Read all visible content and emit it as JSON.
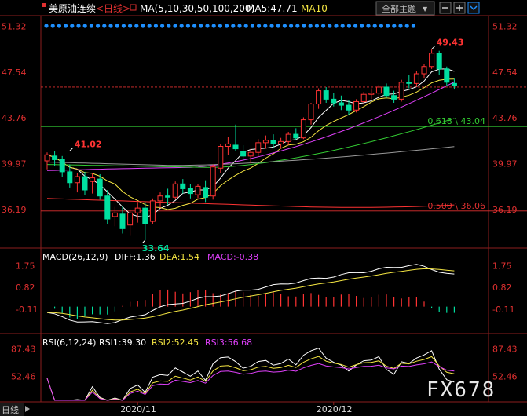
{
  "header": {
    "instrument": "美原油连续",
    "period": "<日线>",
    "ma_label": "MA(5,10,30,50,100,200)",
    "ma5_label": "MA5:47.71",
    "ma10_label": "MA10",
    "theme_button": "全部主题",
    "theme_arrow": "▼"
  },
  "watermark": "FX678",
  "bottom_tab": "日线",
  "colors": {
    "up": "#ff3333",
    "down": "#00e0a0",
    "ma5": "#ffffff",
    "ma10": "#f5e642",
    "ma30": "#e040fb",
    "ma50": "#33cc33",
    "ma100": "#999999",
    "ma200": "#ff3333",
    "axis_text": "#e03030",
    "dot_row": "#1e90ff"
  },
  "chart_data": {
    "type": "candlestick",
    "x_ticks": [
      "2020/11",
      "2020/12"
    ],
    "price_panel": {
      "y_ticks": [
        "51.32",
        "47.54",
        "43.76",
        "39.97",
        "36.19"
      ],
      "ylim": [
        33.0,
        52.2
      ],
      "annotations": [
        {
          "label": "49.43",
          "value": 49.43,
          "index": 51
        },
        {
          "label": "41.02",
          "value": 41.02,
          "index": 3
        },
        {
          "label": "33.64",
          "value": 33.64,
          "index": 13
        }
      ],
      "reference_lines": [
        {
          "label": "",
          "value": 46.3,
          "style": "dashed"
        },
        {
          "label": "0.618 \\ 43.04",
          "value": 43.04,
          "style": "solid"
        },
        {
          "label": "0.500 \\ 36.06",
          "value": 36.06,
          "style": "solid"
        }
      ],
      "candles": [
        {
          "o": 40.2,
          "h": 40.9,
          "l": 39.5,
          "c": 40.7
        },
        {
          "o": 40.6,
          "h": 41.02,
          "l": 39.8,
          "c": 40.3
        },
        {
          "o": 40.3,
          "h": 40.6,
          "l": 38.9,
          "c": 39.3
        },
        {
          "o": 39.3,
          "h": 39.9,
          "l": 38.0,
          "c": 38.4
        },
        {
          "o": 38.4,
          "h": 39.2,
          "l": 37.6,
          "c": 38.9
        },
        {
          "o": 38.9,
          "h": 39.3,
          "l": 37.4,
          "c": 37.8
        },
        {
          "o": 38.5,
          "h": 39.2,
          "l": 37.5,
          "c": 38.8
        },
        {
          "o": 38.7,
          "h": 39.1,
          "l": 37.0,
          "c": 37.3
        },
        {
          "o": 37.3,
          "h": 37.8,
          "l": 35.0,
          "c": 35.4
        },
        {
          "o": 35.6,
          "h": 36.4,
          "l": 34.8,
          "c": 35.9
        },
        {
          "o": 35.8,
          "h": 36.5,
          "l": 34.2,
          "c": 34.6
        },
        {
          "o": 34.9,
          "h": 36.2,
          "l": 34.0,
          "c": 35.9
        },
        {
          "o": 35.9,
          "h": 36.8,
          "l": 35.1,
          "c": 36.3
        },
        {
          "o": 36.3,
          "h": 36.8,
          "l": 33.64,
          "c": 35.0
        },
        {
          "o": 35.2,
          "h": 37.1,
          "l": 35.0,
          "c": 36.9
        },
        {
          "o": 36.9,
          "h": 37.6,
          "l": 36.3,
          "c": 37.3
        },
        {
          "o": 37.3,
          "h": 37.9,
          "l": 36.6,
          "c": 37.2
        },
        {
          "o": 37.2,
          "h": 38.5,
          "l": 37.0,
          "c": 38.3
        },
        {
          "o": 38.3,
          "h": 38.7,
          "l": 37.5,
          "c": 37.9
        },
        {
          "o": 37.9,
          "h": 38.3,
          "l": 37.1,
          "c": 37.5
        },
        {
          "o": 37.4,
          "h": 38.3,
          "l": 37.1,
          "c": 38.1
        },
        {
          "o": 38.0,
          "h": 38.6,
          "l": 36.8,
          "c": 37.2
        },
        {
          "o": 37.3,
          "h": 39.9,
          "l": 37.0,
          "c": 39.7
        },
        {
          "o": 39.6,
          "h": 41.6,
          "l": 39.2,
          "c": 41.4
        },
        {
          "o": 41.4,
          "h": 42.2,
          "l": 40.7,
          "c": 41.6
        },
        {
          "o": 41.5,
          "h": 43.2,
          "l": 41.0,
          "c": 41.2
        },
        {
          "o": 41.0,
          "h": 41.5,
          "l": 40.2,
          "c": 40.6
        },
        {
          "o": 40.6,
          "h": 41.2,
          "l": 40.0,
          "c": 40.9
        },
        {
          "o": 40.9,
          "h": 42.0,
          "l": 40.6,
          "c": 41.7
        },
        {
          "o": 41.7,
          "h": 42.3,
          "l": 41.2,
          "c": 41.9
        },
        {
          "o": 41.9,
          "h": 42.4,
          "l": 41.3,
          "c": 41.6
        },
        {
          "o": 41.6,
          "h": 42.1,
          "l": 41.2,
          "c": 41.8
        },
        {
          "o": 41.8,
          "h": 42.6,
          "l": 41.5,
          "c": 42.4
        },
        {
          "o": 42.4,
          "h": 42.9,
          "l": 41.9,
          "c": 42.1
        },
        {
          "o": 42.1,
          "h": 43.8,
          "l": 42.0,
          "c": 43.6
        },
        {
          "o": 43.6,
          "h": 45.0,
          "l": 43.2,
          "c": 44.9
        },
        {
          "o": 44.9,
          "h": 46.2,
          "l": 44.5,
          "c": 46.0
        },
        {
          "o": 46.0,
          "h": 46.3,
          "l": 45.0,
          "c": 45.3
        },
        {
          "o": 45.3,
          "h": 45.8,
          "l": 44.7,
          "c": 45.0
        },
        {
          "o": 45.0,
          "h": 45.6,
          "l": 44.4,
          "c": 44.8
        },
        {
          "o": 44.8,
          "h": 45.2,
          "l": 44.0,
          "c": 44.4
        },
        {
          "o": 44.4,
          "h": 45.3,
          "l": 44.2,
          "c": 45.1
        },
        {
          "o": 45.1,
          "h": 45.9,
          "l": 44.9,
          "c": 45.7
        },
        {
          "o": 45.7,
          "h": 46.2,
          "l": 45.3,
          "c": 45.8
        },
        {
          "o": 45.8,
          "h": 46.5,
          "l": 45.5,
          "c": 46.3
        },
        {
          "o": 46.3,
          "h": 46.6,
          "l": 45.4,
          "c": 45.6
        },
        {
          "o": 45.6,
          "h": 46.0,
          "l": 45.0,
          "c": 45.3
        },
        {
          "o": 45.3,
          "h": 46.9,
          "l": 45.1,
          "c": 46.7
        },
        {
          "o": 46.7,
          "h": 47.3,
          "l": 46.2,
          "c": 46.6
        },
        {
          "o": 46.6,
          "h": 47.6,
          "l": 46.3,
          "c": 47.4
        },
        {
          "o": 47.4,
          "h": 48.2,
          "l": 47.0,
          "c": 48.0
        },
        {
          "o": 48.0,
          "h": 49.43,
          "l": 47.8,
          "c": 49.1
        },
        {
          "o": 49.1,
          "h": 49.3,
          "l": 47.3,
          "c": 47.8
        },
        {
          "o": 47.8,
          "h": 48.0,
          "l": 46.4,
          "c": 46.7
        },
        {
          "o": 46.6,
          "h": 47.0,
          "l": 46.1,
          "c": 46.4
        }
      ]
    },
    "macd_panel": {
      "label": "MACD(26,12,9)",
      "diff_label": "DIFF:1.36",
      "dea_label": "DEA:1.54",
      "macd_label": "MACD:-0.38",
      "y_ticks": [
        "1.75",
        "0.82",
        "-0.11"
      ],
      "ylim": [
        -0.85,
        2.1
      ]
    },
    "rsi_panel": {
      "label": "RSI(6,12,24)",
      "rsi1_label": "RSI1:39.30",
      "rsi2_label": "RSI2:52.45",
      "rsi3_label": "RSI3:56.68",
      "y_ticks": [
        "87.43",
        "52.46"
      ],
      "ylim": [
        20,
        100
      ]
    }
  }
}
